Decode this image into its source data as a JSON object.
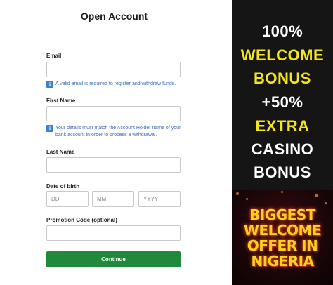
{
  "form": {
    "title": "Open Account",
    "email_label": "Email",
    "email_value": "",
    "email_hint": "A valid email is required to register and withdraw funds.",
    "first_name_label": "First Name",
    "first_name_value": "",
    "first_name_hint": "Your details must match the Account Holder name of your bank account in order to process a withdrawal.",
    "last_name_label": "Last Name",
    "last_name_value": "",
    "dob_label": "Date of birth",
    "dob_day_placeholder": "DD",
    "dob_month_placeholder": "MM",
    "dob_year_placeholder": "YYYY",
    "promo_label": "Promotion Code (optional)",
    "promo_value": "",
    "continue_label": "Continue",
    "hint_icon": "info-icon"
  },
  "promo_panel": {
    "lines": [
      "100%",
      "WELCOME",
      "BONUS",
      "+50%",
      "EXTRA",
      "CASINO",
      "BONUS"
    ],
    "banner_lines": [
      "BIGGEST",
      "WELCOME",
      "OFFER IN",
      "NIGERIA"
    ],
    "colors": {
      "background": "#151515",
      "white": "#ffffff",
      "yellow": "#f7e51c",
      "banner_text": "#ffd21f"
    }
  },
  "colors": {
    "continue_button": "#1f8a3b",
    "hint_text": "#3d6cb0",
    "info_icon": "#3f7fd0"
  }
}
